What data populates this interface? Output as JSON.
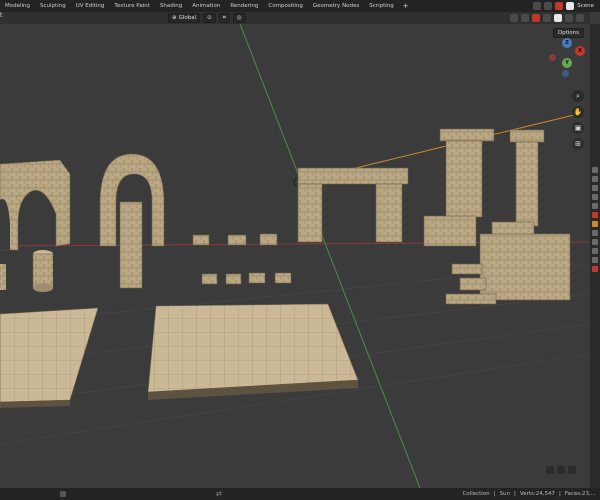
{
  "workspace_tabs": [
    {
      "label": "Modeling",
      "active": false
    },
    {
      "label": "Sculpting",
      "active": false
    },
    {
      "label": "UV Editing",
      "active": false
    },
    {
      "label": "Texture Paint",
      "active": false
    },
    {
      "label": "Shading",
      "active": false
    },
    {
      "label": "Animation",
      "active": false
    },
    {
      "label": "Rendering",
      "active": false
    },
    {
      "label": "Compositing",
      "active": false
    },
    {
      "label": "Geometry Nodes",
      "active": false
    },
    {
      "label": "Scripting",
      "active": false
    }
  ],
  "add_tab_label": "+",
  "scene": {
    "label": "Scene"
  },
  "header": {
    "left_label": "t",
    "transform_orientation": "Global",
    "options_label": "Options"
  },
  "gizmo": {
    "x": "X",
    "y": "Y",
    "z": "Z"
  },
  "status": {
    "collection": "Collection",
    "object": "Sun",
    "verts": "Verts:24,547",
    "faces": "Faces:23,..."
  },
  "colors": {
    "axis_x": "#c0392b",
    "axis_y": "#6aa84f",
    "axis_z": "#4b7bbf",
    "stone": "#b8a585",
    "stone_dark": "#8c7b5e"
  }
}
